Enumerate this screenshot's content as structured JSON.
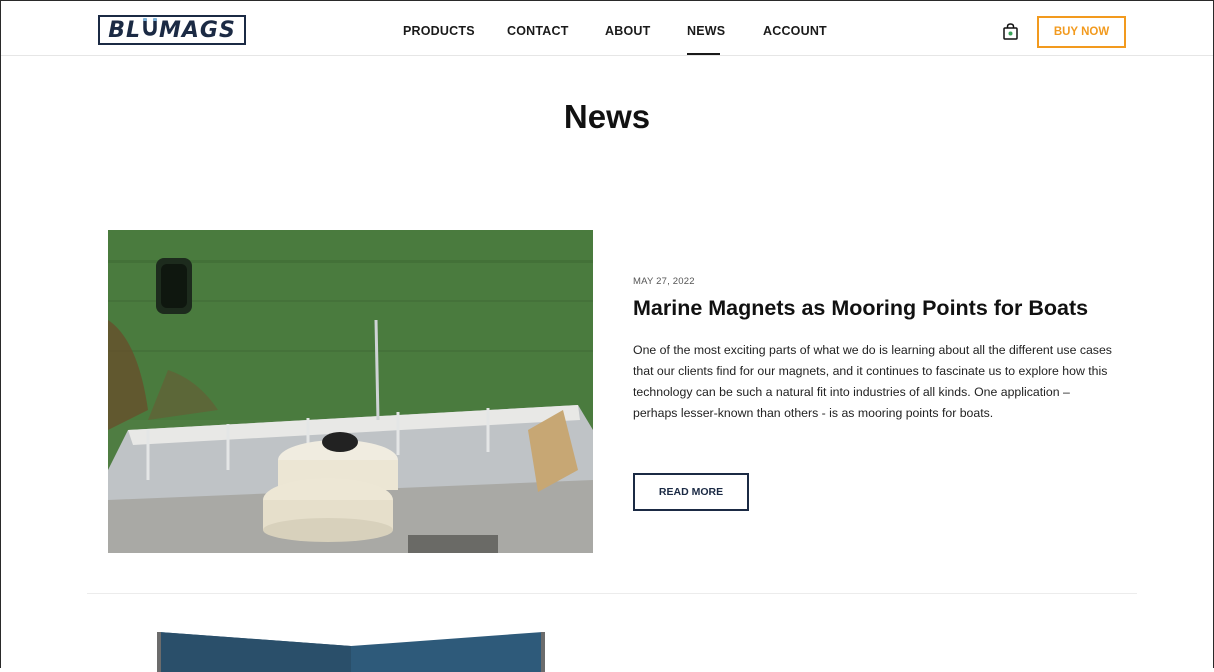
{
  "brand": {
    "logo_text_left": "BL",
    "logo_text_right": "MAGS"
  },
  "nav": {
    "items": [
      {
        "label": "PRODUCTS"
      },
      {
        "label": "CONTACT"
      },
      {
        "label": "ABOUT"
      },
      {
        "label": "NEWS",
        "active": true
      },
      {
        "label": "ACCOUNT"
      }
    ],
    "cart_icon": "shopping-bag-icon",
    "buy_now_label": "BUY NOW"
  },
  "page": {
    "title": "News"
  },
  "articles": [
    {
      "date": "MAY 27, 2022",
      "title": "Marine Magnets as Mooring Points for Boats",
      "excerpt": "One of the most exciting parts of what we do is learning about all the different use cases that our clients find for our magnets, and it continues to fascinate us to explore how this technology can be such a natural fit into industries of all kinds. One application – perhaps lesser-known than others - is as mooring points for boats.",
      "read_more_label": "READ MORE"
    }
  ],
  "colors": {
    "accent_orange": "#f29a1e",
    "brand_navy": "#1b2a44",
    "text_dark": "#111111"
  }
}
